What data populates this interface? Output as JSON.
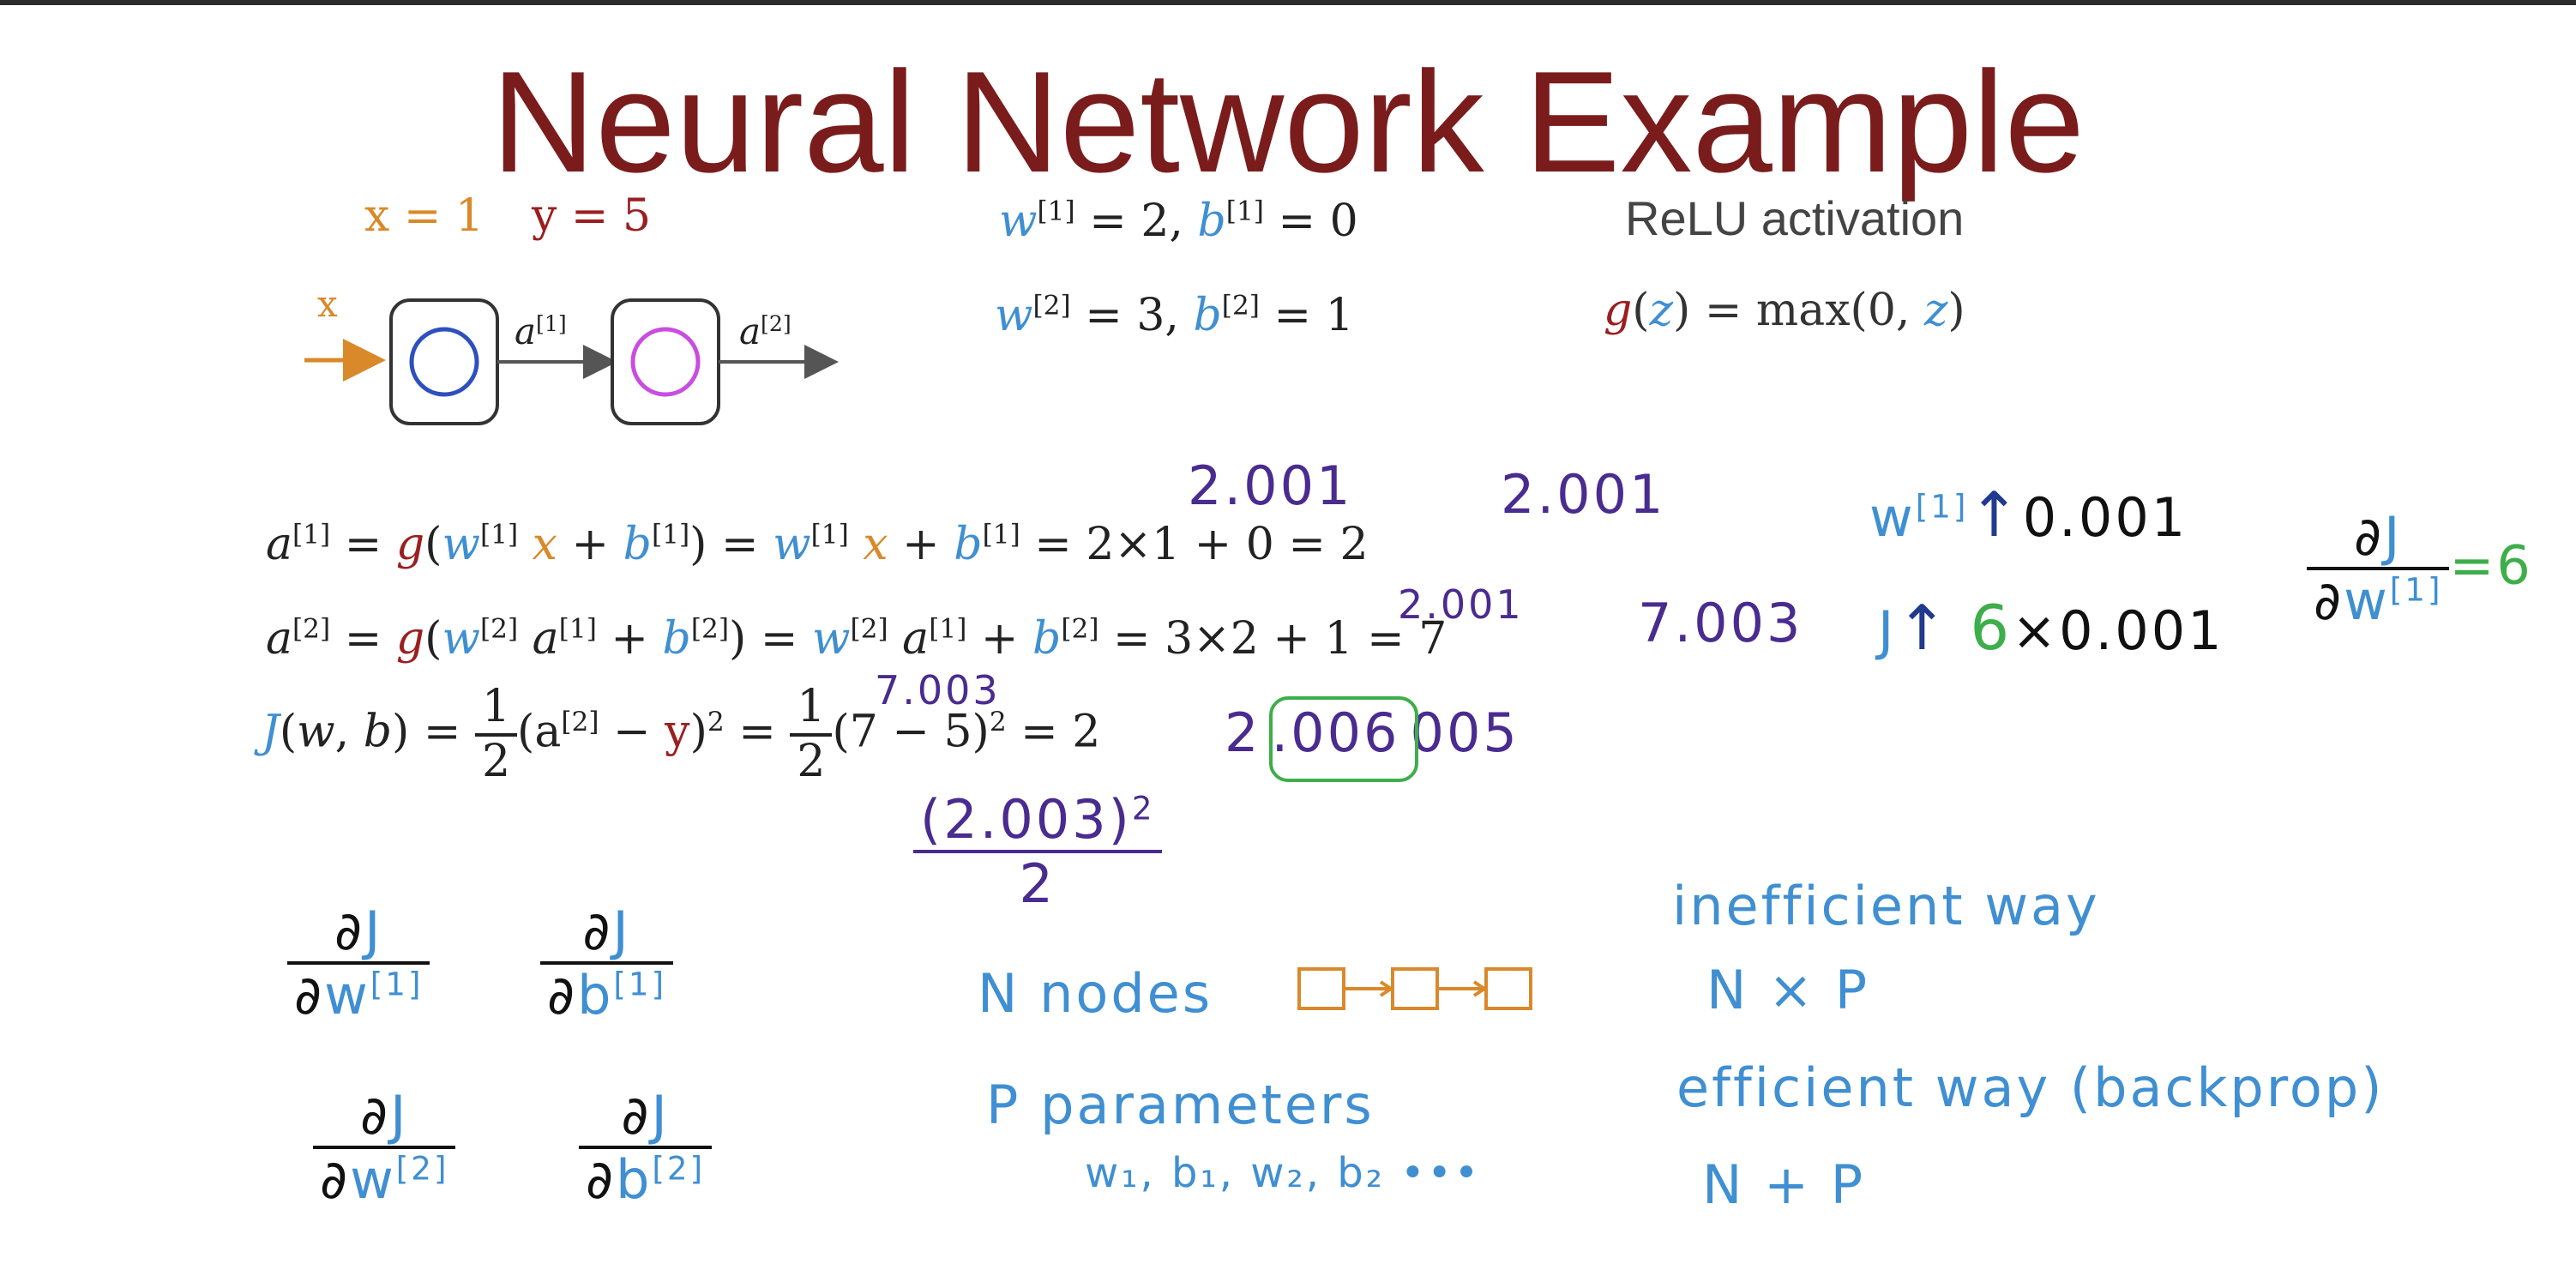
{
  "slide": {
    "title": "Neural Network Example",
    "given": {
      "x_eq": "x = 1",
      "y_eq": "y = 5"
    },
    "params": {
      "w1": "w",
      "w1_sup": "[1]",
      "w1_val": " = 2,",
      "b1": "b",
      "b1_sup": "[1]",
      "b1_val": " = 0",
      "w2": "w",
      "w2_sup": "[2]",
      "w2_val": " = 3,",
      "b2": "b",
      "b2_sup": "[2]",
      "b2_val": " = 1"
    },
    "activation": {
      "label": "ReLU activation",
      "g": "g",
      "z": "z",
      "rest1": "(",
      "rest2": ") = max(0, ",
      "rest3": ")"
    },
    "network": {
      "input": "x",
      "a1": "a",
      "a1_sup": "[1]",
      "a2": "a",
      "a2_sup": "[2]"
    },
    "eq1": {
      "lhs": "a",
      "lhs_sup": "[1]",
      "eqg": " = ",
      "g": "g",
      "open": "(",
      "w": "w",
      "w_sup": "[1]",
      "x": "x",
      "plus": " + ",
      "b": "b",
      "b_sup": "[1]",
      "close": ")",
      "eq2": " = ",
      "w2": "w",
      "w2_sup": "[1]",
      "x2": "x",
      "plus2": " + ",
      "b2": "b",
      "b2_sup": "[1]",
      "tail": " = 2×1 + 0 = 2"
    },
    "eq2": {
      "lhs": "a",
      "lhs_sup": "[2]",
      "eqg": " = ",
      "g": "g",
      "open": "(",
      "w": "w",
      "w_sup": "[2]",
      "a": "a",
      "a_sup": "[1]",
      "plus": " + ",
      "b": "b",
      "b_sup": "[2]",
      "close": ")",
      "eq2": " = ",
      "w2": "w",
      "w2_sup": "[2]",
      "a2": "a",
      "a2_sup": "[1]",
      "plus2": " + ",
      "b2": "b",
      "b2_sup": "[2]",
      "tail": " =  3×2 + 1 = 7"
    },
    "eq3": {
      "J": "J",
      "args_open": "(",
      "w": "w",
      "comma": ", ",
      "b": "b",
      "args_close": ") = ",
      "half_n": "1",
      "half_d": "2",
      "sq_open": "(a",
      "sq_sup": "[2]",
      "minus": " − ",
      "y": "y",
      "sq_close": ")",
      "pow": "2",
      "eq": " = ",
      "half2_n": "1",
      "half2_d": "2",
      "mid": "(7 − 5)",
      "pow2": "2",
      "tail": " = 2"
    },
    "annotations": {
      "a1_new_above": "2.001",
      "a1_new_right": "2.001",
      "a2_sub": "2.001",
      "a2_new": "7.003",
      "j_sub": "7.003",
      "j_new_a": "2",
      "j_new_b": ".006",
      "j_new_c": "005",
      "j_frac_n": "(2.003)",
      "j_frac_pow": "2",
      "j_frac_d": "2"
    },
    "right_notes": {
      "w_line": "w",
      "w_sup": "[1]",
      "w_arrow": "↑",
      "w_step": "0.001",
      "j_line": "J",
      "j_arrow": "↑",
      "j_mult": "6",
      "j_times": "×0.001",
      "deriv_n_d": "∂",
      "deriv_n_J": "J",
      "deriv_d_d": "∂",
      "deriv_d_w": "w",
      "deriv_d_sup": "[1]",
      "deriv_eq": "=",
      "deriv_val": "6"
    },
    "partials": [
      {
        "num_d": "∂",
        "num_J": "J",
        "den_d": "∂",
        "den_v": "w",
        "den_sup": "[1]"
      },
      {
        "num_d": "∂",
        "num_J": "J",
        "den_d": "∂",
        "den_v": "b",
        "den_sup": "[1]"
      },
      {
        "num_d": "∂",
        "num_J": "J",
        "den_d": "∂",
        "den_v": "w",
        "den_sup": "[2]"
      },
      {
        "num_d": "∂",
        "num_J": "J",
        "den_d": "∂",
        "den_v": "b",
        "den_sup": "[2]"
      }
    ],
    "counts": {
      "n_nodes": "N nodes",
      "p_params": "P parameters",
      "param_list": "w₁, b₁, w₂, b₂ •••",
      "inefficient": "inefficient way",
      "n_times_p": "N × P",
      "efficient": "efficient way (backprop)",
      "n_plus_p": "N + P"
    }
  }
}
